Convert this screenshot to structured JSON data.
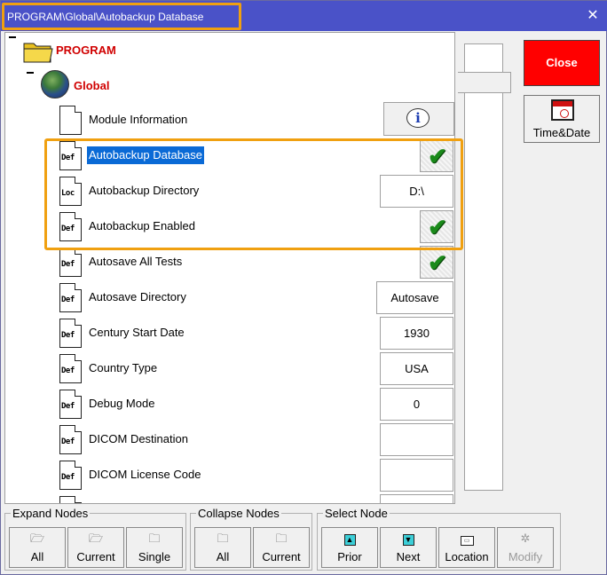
{
  "window": {
    "title": "PROGRAM\\Global\\Autobackup Database"
  },
  "tree": {
    "root": {
      "label": "PROGRAM"
    },
    "global": {
      "label": "Global"
    },
    "items": [
      {
        "type": "",
        "label": "Module Information",
        "value_kind": "info"
      },
      {
        "type": "Def",
        "label": "Autobackup Database",
        "value_kind": "check",
        "selected": true
      },
      {
        "type": "Loc",
        "label": "Autobackup Directory",
        "value_kind": "text",
        "value": "D:\\"
      },
      {
        "type": "Def",
        "label": "Autobackup Enabled",
        "value_kind": "check"
      },
      {
        "type": "Def",
        "label": "Autosave All Tests",
        "value_kind": "check"
      },
      {
        "type": "Def",
        "label": "Autosave Directory",
        "value_kind": "text",
        "value": "Autosave"
      },
      {
        "type": "Def",
        "label": "Century Start Date",
        "value_kind": "text",
        "value": "1930"
      },
      {
        "type": "Def",
        "label": "Country Type",
        "value_kind": "text",
        "value": "USA"
      },
      {
        "type": "Def",
        "label": "Debug Mode",
        "value_kind": "text",
        "value": "0"
      },
      {
        "type": "Def",
        "label": "DICOM Destination",
        "value_kind": "text",
        "value": ""
      },
      {
        "type": "Def",
        "label": "DICOM License Code",
        "value_kind": "text",
        "value": ""
      }
    ],
    "info_glyph": "i",
    "check_glyph": "✔"
  },
  "side_buttons": {
    "close": "Close",
    "time_date": "Time&Date"
  },
  "toolbar": {
    "expand": {
      "title": "Expand Nodes",
      "all": "All",
      "current": "Current",
      "single": "Single"
    },
    "collapse": {
      "title": "Collapse Nodes",
      "all": "All",
      "current": "Current"
    },
    "select": {
      "title": "Select Node",
      "prior": "Prior",
      "next": "Next",
      "location": "Location",
      "modify": "Modify"
    }
  },
  "colors": {
    "titlebar": "#4a52c8",
    "highlight": "#f0a010",
    "close_button": "#ff0000",
    "node_label": "#d00000",
    "selection": "#0a6ad6"
  }
}
